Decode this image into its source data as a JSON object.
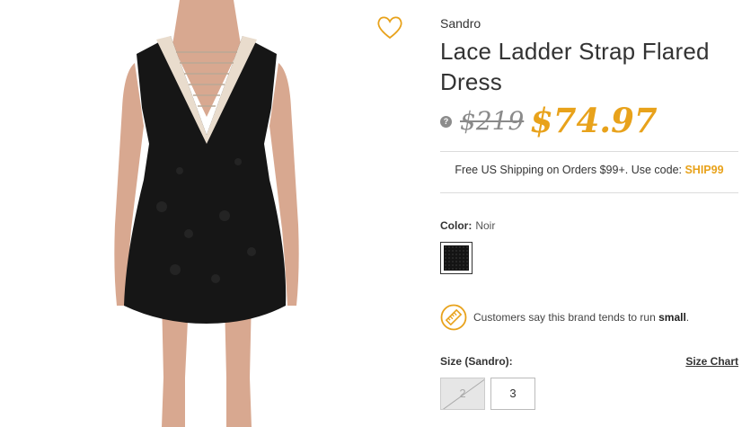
{
  "product": {
    "brand": "Sandro",
    "title": "Lace Ladder Strap Flared Dress",
    "original_price": "$219",
    "sale_price": "$74.97",
    "price_info_icon": "?"
  },
  "shipping": {
    "text": "Free US Shipping on Orders $99+. Use code: ",
    "code": "SHIP99"
  },
  "color": {
    "label": "Color:",
    "value": "Noir",
    "swatch_color": "#141414"
  },
  "fit": {
    "text": "Customers say this brand tends to run ",
    "emphasis": "small",
    "suffix": "."
  },
  "size": {
    "label": "Size (Sandro):",
    "chart_link": "Size Chart",
    "options": [
      {
        "label": "2",
        "available": false
      },
      {
        "label": "3",
        "available": true
      }
    ]
  },
  "colors": {
    "accent": "#e8a21b",
    "text": "#333333"
  },
  "icons": {
    "wishlist": "heart-icon",
    "fit": "ruler-icon",
    "info": "question-icon"
  }
}
